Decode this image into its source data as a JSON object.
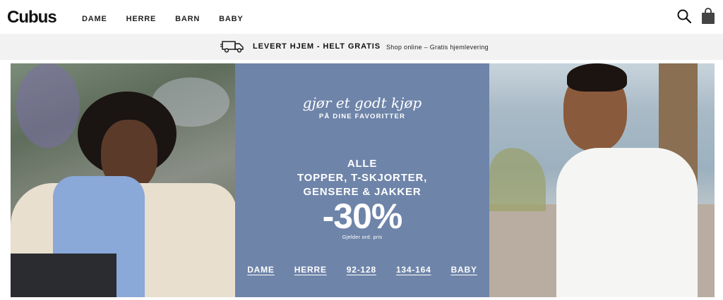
{
  "header": {
    "logo": "Cubus",
    "nav": [
      "DAME",
      "HERRE",
      "BARN",
      "BABY"
    ]
  },
  "icons": {
    "search": "search-icon",
    "bag": "shopping-bag-icon",
    "truck": "truck-icon"
  },
  "promo_bar": {
    "main": "LEVERT HJEM - HELT GRATIS",
    "sub": "Shop online – Gratis hjemlevering"
  },
  "hero": {
    "script_title": "gjør et godt kjøp",
    "script_sub": "PÅ DINE FAVORITTER",
    "line1": "ALLE",
    "line2": "TOPPER, T-SKJORTER,",
    "line3": "GENSERE & JAKKER",
    "discount": "-30%",
    "note": "Gjelder ord. pris",
    "links": [
      "DAME",
      "HERRE",
      "92-128",
      "134-164",
      "BABY"
    ]
  },
  "colors": {
    "panel": "#6e84a9",
    "promo_bg": "#f2f2f2",
    "text": "#111111"
  }
}
